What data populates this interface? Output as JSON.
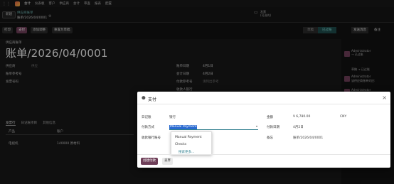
{
  "navbar": {
    "app": "会计",
    "menu": [
      "仪表板",
      "客户",
      "供应商",
      "会计",
      "审查",
      "报表",
      "配置"
    ]
  },
  "control": {
    "new_label": "新建",
    "breadcrumb_parent": "供应商账单",
    "breadcrumb_current": "账单/2026/04/0001",
    "attachment_label": "发票",
    "attachment_sub": "(可选的)"
  },
  "actions": {
    "buttons": [
      "打印",
      "支付",
      "添加调整",
      "重置为草稿"
    ],
    "status": [
      "草稿",
      "已过账"
    ],
    "status_active_index": 1,
    "send_message": "发送消息",
    "note": "备注"
  },
  "form": {
    "doc_type": "供应商账单",
    "title": "账单/2026/04/0001",
    "fields_left": [
      {
        "label": "供应商",
        "value": "供应",
        "muted": false
      },
      {
        "label": "账单参考号",
        "value": "",
        "muted": false
      },
      {
        "label": "发票号码",
        "value": "",
        "muted": false
      }
    ],
    "fields_right": [
      {
        "label": "账单日期",
        "value": "4月1日",
        "muted": false
      },
      {
        "label": "会计日期",
        "value": "4月2日",
        "muted": false
      },
      {
        "label": "付款参考号",
        "value": "请列出参考",
        "muted": true
      },
      {
        "label": "收款人银行",
        "value": "",
        "muted": false
      }
    ],
    "tabs": [
      "发票行",
      "日记账项目",
      "其他信息"
    ],
    "columns": [
      "产品",
      "账户"
    ],
    "row": {
      "product": "电视机",
      "account": "140000 原材料"
    }
  },
  "chatter": {
    "messages": [
      "Administrator",
      "→ 已过账",
      "草稿 → 已过账",
      "Administrator",
      "该供应商账单对应:",
      "Administrator",
      "供应商账单已"
    ]
  },
  "dialog": {
    "title": "支付",
    "journal_label": "日记账",
    "journal_value": "银行",
    "method_label": "付款方式",
    "method_value": "Manual Payment",
    "bank_label": "收款银行账号",
    "amount_label": "金额",
    "amount_value": "¥ 6,780.00",
    "currency": "CNY",
    "date_label": "付款日期",
    "date_value": "4月2日",
    "memo_label": "备忘",
    "memo_value": "账单/2026/04/0001",
    "dropdown_options": [
      "Manual Payment",
      "Checks"
    ],
    "dropdown_more": "搜索更多...",
    "confirm_label": "创建付款",
    "discard_label": "丢弃"
  }
}
